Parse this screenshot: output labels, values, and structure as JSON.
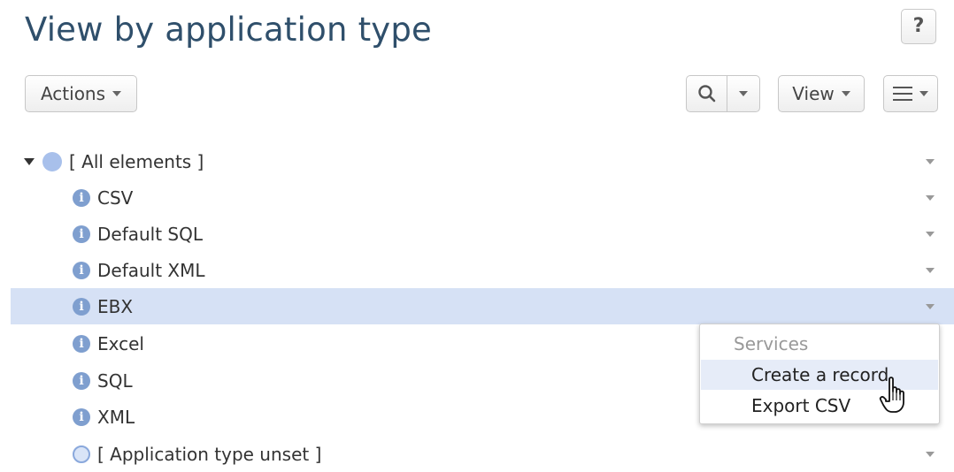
{
  "header": {
    "title": "View by application type",
    "help_label": "?"
  },
  "toolbar": {
    "actions_label": "Actions",
    "view_label": "View",
    "search_icon": "search-icon",
    "menu_icon": "hamburger-menu-icon"
  },
  "tree": {
    "root": {
      "label": "[ All elements ]"
    },
    "items": [
      {
        "label": "CSV"
      },
      {
        "label": "Default SQL"
      },
      {
        "label": "Default XML"
      },
      {
        "label": "EBX",
        "selected": true
      },
      {
        "label": "Excel"
      },
      {
        "label": "SQL"
      },
      {
        "label": "XML"
      }
    ],
    "unset": {
      "label": "[ Application type unset ]"
    }
  },
  "context_menu": {
    "header": "Services",
    "items": [
      {
        "label": "Create a record"
      },
      {
        "label": "Export CSV"
      }
    ]
  },
  "colors": {
    "accent": "#2f4f6b",
    "selected_row": "#d6e1f5",
    "menu_hover": "#e6ecf8",
    "icon_blue": "#7f9fcf"
  }
}
